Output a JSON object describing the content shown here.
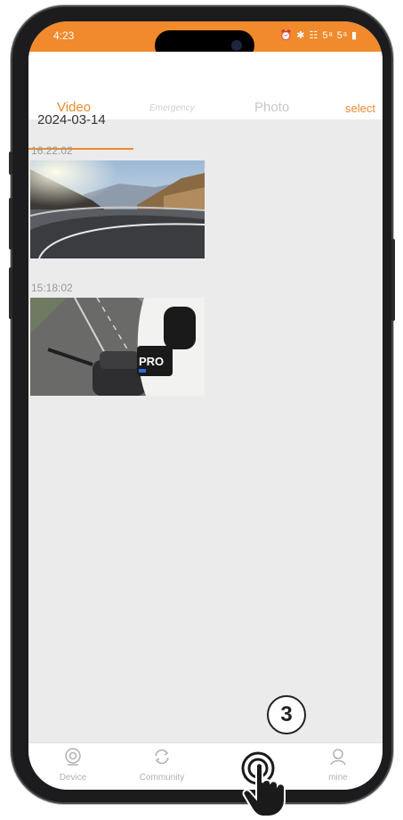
{
  "status_bar": {
    "time": "4:23",
    "icons": "⏰ ✱ ☷ 5ᵃ 5ᵃ ▮"
  },
  "tabs": [
    {
      "label": "Video",
      "active": true
    },
    {
      "label": "Emergency",
      "active": false
    },
    {
      "label": "Photo",
      "active": false
    }
  ],
  "select_label": "select",
  "date_header": "2024-03-14",
  "clips": [
    {
      "time": "16:22:02",
      "thumbnail": "mountain-road-thumbnail"
    },
    {
      "time": "15:18:02",
      "thumbnail": "motorcycle-gopro-thumbnail"
    }
  ],
  "bottom_nav": [
    {
      "label": "Device",
      "icon": "camera-icon"
    },
    {
      "label": "Community",
      "icon": "refresh-icon"
    },
    {
      "label": "",
      "icon": "album-icon"
    },
    {
      "label": "mine",
      "icon": "user-icon"
    }
  ],
  "annotation": {
    "step_number": "3"
  },
  "colors": {
    "accent": "#f08a2c",
    "background": "#ebebeb"
  }
}
